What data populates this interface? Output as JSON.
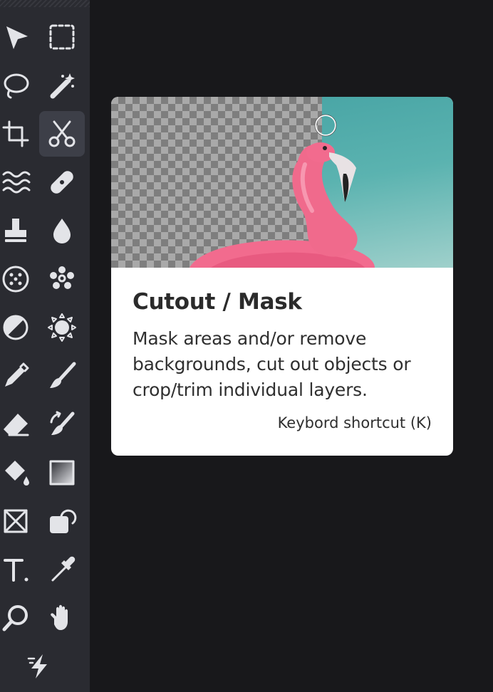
{
  "toolbar": {
    "tools": [
      {
        "id": "select",
        "icon": "pointer-icon"
      },
      {
        "id": "marquee",
        "icon": "rect-select-icon"
      },
      {
        "id": "lasso",
        "icon": "lasso-icon"
      },
      {
        "id": "magic-wand",
        "icon": "magic-wand-icon"
      },
      {
        "id": "crop",
        "icon": "crop-icon"
      },
      {
        "id": "cutout",
        "icon": "scissors-icon",
        "active": true
      },
      {
        "id": "liquify",
        "icon": "waves-icon"
      },
      {
        "id": "heal",
        "icon": "bandage-icon"
      },
      {
        "id": "clone",
        "icon": "stamp-icon"
      },
      {
        "id": "blur",
        "icon": "drop-icon"
      },
      {
        "id": "pattern",
        "icon": "dots-circle-icon"
      },
      {
        "id": "effects",
        "icon": "cluster-icon"
      },
      {
        "id": "dodge",
        "icon": "half-circle-icon"
      },
      {
        "id": "sponge",
        "icon": "sun-icon"
      },
      {
        "id": "pen",
        "icon": "pen-icon"
      },
      {
        "id": "brush",
        "icon": "brush-icon"
      },
      {
        "id": "eraser",
        "icon": "eraser-icon"
      },
      {
        "id": "replace-color",
        "icon": "brush-swap-icon"
      },
      {
        "id": "fill",
        "icon": "bucket-icon"
      },
      {
        "id": "gradient",
        "icon": "gradient-icon"
      },
      {
        "id": "frame",
        "icon": "frame-icon"
      },
      {
        "id": "shape",
        "icon": "shape-icon"
      },
      {
        "id": "text",
        "icon": "text-icon"
      },
      {
        "id": "eyedropper",
        "icon": "eyedropper-icon"
      },
      {
        "id": "zoom",
        "icon": "magnifier-icon"
      },
      {
        "id": "hand",
        "icon": "hand-icon"
      },
      {
        "id": "quick-actions",
        "icon": "lightning-icon"
      }
    ]
  },
  "tooltip": {
    "title": "Cutout / Mask",
    "description": "Mask areas and/or remove backgrounds, cut out objects or crop/trim individual layers.",
    "shortcut": "Keybord shortcut (K)"
  },
  "colors": {
    "toolbar_bg": "#2a2b31",
    "canvas_bg": "#18181b",
    "icon": "#e3e4e8",
    "active_tool_bg": "#3d3f48",
    "flamingo_pink": "#f06a8c",
    "sky_teal": "#4aa6a6"
  }
}
